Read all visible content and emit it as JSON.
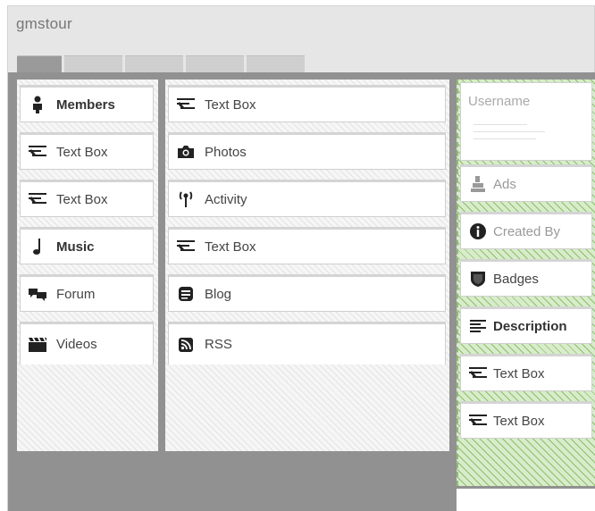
{
  "window": {
    "title": "gmstour"
  },
  "tabs": [
    {
      "label": "",
      "active": true
    },
    {
      "label": "",
      "active": false
    },
    {
      "label": "",
      "active": false
    },
    {
      "label": "",
      "active": false
    },
    {
      "label": "",
      "active": false
    }
  ],
  "column1": {
    "widgets": [
      {
        "label": "Members",
        "icon": "person-icon"
      },
      {
        "label": "Text Box",
        "icon": "text-box-icon"
      },
      {
        "label": "Text Box",
        "icon": "text-box-icon"
      },
      {
        "label": "Music",
        "icon": "music-note-icon"
      },
      {
        "label": "Forum",
        "icon": "chat-bubbles-icon"
      },
      {
        "label": "Videos",
        "icon": "clapperboard-icon"
      }
    ]
  },
  "column2": {
    "widgets": [
      {
        "label": "Text Box",
        "icon": "text-box-icon"
      },
      {
        "label": "Photos",
        "icon": "camera-icon"
      },
      {
        "label": "Activity",
        "icon": "signal-tower-icon"
      },
      {
        "label": "Text Box",
        "icon": "text-box-icon"
      },
      {
        "label": "Blog",
        "icon": "blog-icon"
      },
      {
        "label": "RSS",
        "icon": "rss-icon"
      }
    ]
  },
  "column3": {
    "username": {
      "label": "Username"
    },
    "widgets": [
      {
        "label": "Ads",
        "icon": "ads-icon"
      },
      {
        "label": "Created By",
        "icon": "info-icon"
      },
      {
        "label": "Badges",
        "icon": "shield-icon"
      },
      {
        "label": "Description",
        "icon": "align-left-icon"
      },
      {
        "label": "Text Box",
        "icon": "text-box-icon"
      },
      {
        "label": "Text Box",
        "icon": "text-box-icon"
      }
    ]
  },
  "colors": {
    "panel_gray": "#919191",
    "drop_zone_green": "#8dbf6a",
    "active_tab": "#9a9a9a"
  }
}
